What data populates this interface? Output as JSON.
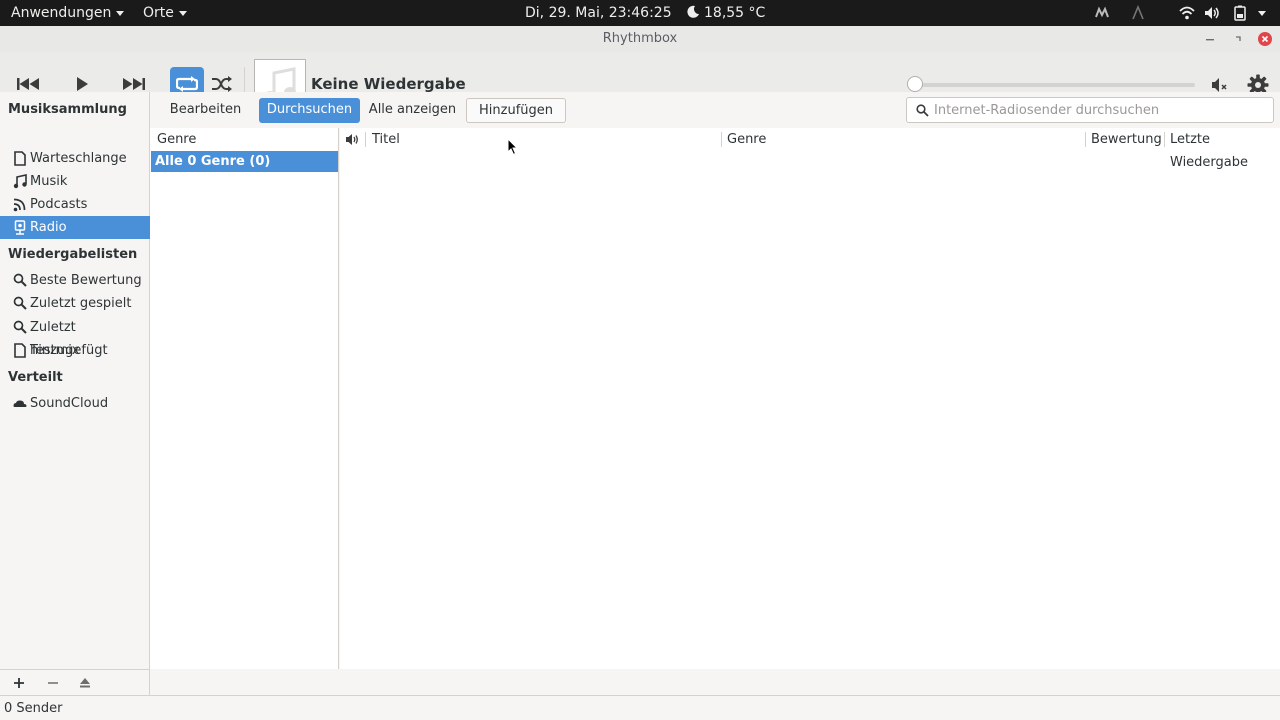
{
  "topbar": {
    "applications": "Anwendungen",
    "places": "Orte",
    "clock": "Di, 29. Mai, 23:46:25",
    "weather": "18,55 °C"
  },
  "window": {
    "title": "Rhythmbox"
  },
  "toolbar": {
    "now_playing": "Keine Wiedergabe",
    "seek_position": 0
  },
  "sidebar": {
    "sections": [
      {
        "title": "Musiksammlung"
      },
      {
        "title": "Wiedergabelisten"
      },
      {
        "title": "Verteilt"
      }
    ],
    "library": [
      {
        "label": "Warteschlange",
        "icon": "document-icon"
      },
      {
        "label": "Musik",
        "icon": "music-note-icon"
      },
      {
        "label": "Podcasts",
        "icon": "rss-icon"
      },
      {
        "label": "Radio",
        "icon": "radio-icon",
        "selected": true
      }
    ],
    "playlists": [
      {
        "label": "Beste Bewertung",
        "icon": "search-icon"
      },
      {
        "label": "Zuletzt gespielt",
        "icon": "search-icon"
      },
      {
        "label": "Zuletzt hinzugefügt",
        "icon": "search-icon"
      },
      {
        "label": "Testmix",
        "icon": "document-icon"
      }
    ],
    "shared": [
      {
        "label": "SoundCloud",
        "icon": "cloud-icon"
      }
    ]
  },
  "browser": {
    "edit": "Bearbeiten",
    "browse": "Durchsuchen",
    "show_all": "Alle anzeigen",
    "add": "Hinzufügen",
    "search_placeholder": "Internet-Radiosender durchsuchen"
  },
  "genre_pane": {
    "header": "Genre",
    "rows": [
      "Alle 0 Genre (0)"
    ]
  },
  "track_pane": {
    "columns": [
      "Titel",
      "Genre",
      "Bewertung",
      "Letzte Wiedergabe"
    ]
  },
  "status": {
    "text": "0 Sender"
  },
  "colors": {
    "accent": "#4a90d9",
    "topbar": "#1a1a1a",
    "close": "#e0454a"
  }
}
